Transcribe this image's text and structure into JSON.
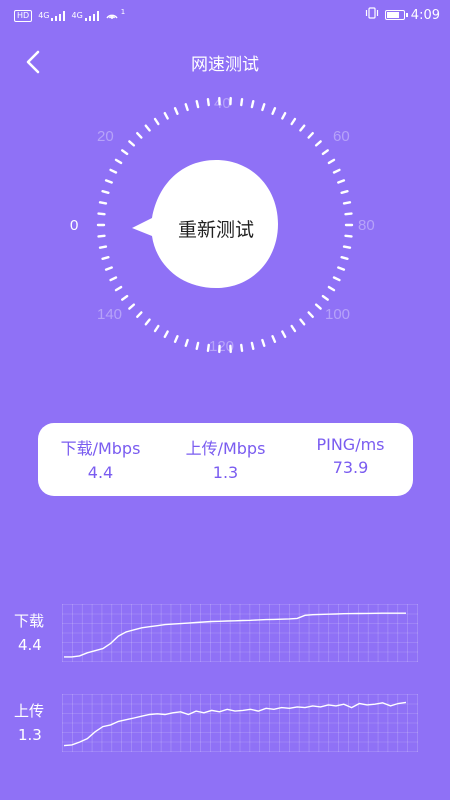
{
  "status_bar": {
    "hd_badge": "HD",
    "net_type_1": "4G",
    "net_type_2": "4G",
    "hotspot_badge": "1",
    "time": "4:09",
    "icons": [
      "hd-icon",
      "signal-icon",
      "signal-icon",
      "hotspot-icon",
      "vibrate-icon",
      "battery-icon"
    ]
  },
  "header": {
    "title": "网速测试",
    "back_icon": "chevron-left-icon"
  },
  "gauge": {
    "button_label": "重新测试",
    "tick_labels": [
      "0",
      "20",
      "40",
      "60",
      "80",
      "100",
      "120",
      "140"
    ],
    "current_value": 0,
    "max_value": 140
  },
  "stats": {
    "download": {
      "label": "下载/Mbps",
      "value": "4.4"
    },
    "upload": {
      "label": "上传/Mbps",
      "value": "1.3"
    },
    "ping": {
      "label": "PING/ms",
      "value": "73.9"
    }
  },
  "charts": {
    "download": {
      "label": "下载",
      "value": "4.4"
    },
    "upload": {
      "label": "上传",
      "value": "1.3"
    }
  },
  "chart_data": [
    {
      "type": "line",
      "series": [
        {
          "values": [
            0.2,
            0.2,
            0.3,
            0.6,
            0.8,
            1.0,
            1.5,
            2.2,
            2.6,
            2.8,
            3.0,
            3.1,
            3.2,
            3.3,
            3.35,
            3.4,
            3.45,
            3.5,
            3.55,
            3.6,
            3.62,
            3.65,
            3.67,
            3.7,
            3.72,
            3.75,
            3.78,
            3.8,
            3.82,
            3.85,
            3.9,
            4.2,
            4.25,
            4.28,
            4.3,
            4.32,
            4.35,
            4.36,
            4.37,
            4.38,
            4.39,
            4.4,
            4.4,
            4.4,
            4.4
          ]
        }
      ],
      "ylim": [
        0,
        4.8
      ],
      "grid": true
    },
    {
      "type": "line",
      "series": [
        {
          "values": [
            0.1,
            0.12,
            0.2,
            0.3,
            0.5,
            0.65,
            0.7,
            0.8,
            0.85,
            0.9,
            0.95,
            1.0,
            1.02,
            1.0,
            1.05,
            1.08,
            1.0,
            1.1,
            1.05,
            1.12,
            1.08,
            1.15,
            1.1,
            1.12,
            1.15,
            1.1,
            1.18,
            1.15,
            1.2,
            1.18,
            1.22,
            1.2,
            1.25,
            1.22,
            1.28,
            1.25,
            1.3,
            1.2,
            1.32,
            1.28,
            1.3,
            1.34,
            1.25,
            1.32,
            1.35
          ]
        }
      ],
      "ylim": [
        0,
        1.45
      ],
      "grid": true
    }
  ]
}
